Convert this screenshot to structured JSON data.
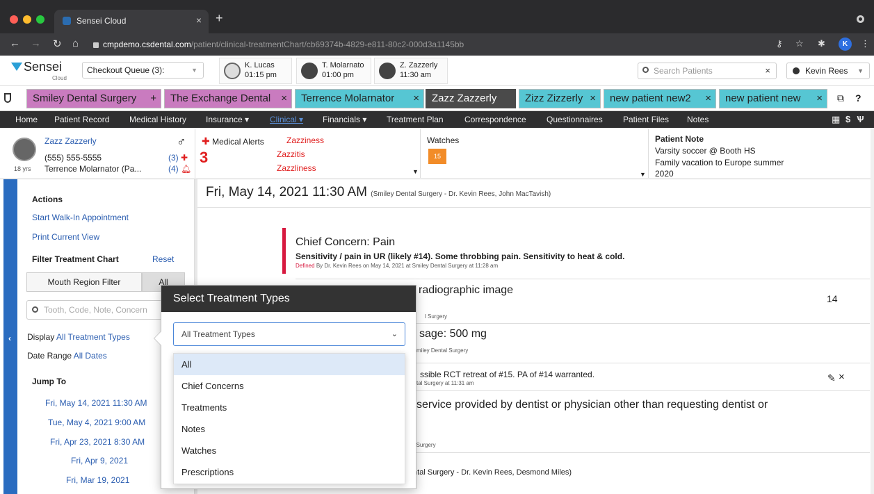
{
  "browser": {
    "tab_title": "Sensei Cloud",
    "url_host": "cmpdemo.csdental.com",
    "url_path": "/patient/clinical-treatmentChart/cb69374b-4829-e811-80c2-000d3a1145bb",
    "profile_initial": "K"
  },
  "app": {
    "logo_name": "Sensei",
    "logo_sub": "Cloud",
    "queue_label": "Checkout Queue (3):",
    "appointments": [
      {
        "name": "K. Lucas",
        "time": "01:15 pm"
      },
      {
        "name": "T. Molarnato",
        "time": "01:00 pm"
      },
      {
        "name": "Z. Zazzerly",
        "time": "11:30 am"
      }
    ],
    "search_placeholder": "Search Patients",
    "user_name": "Kevin Rees"
  },
  "patient_tabs": [
    {
      "label": "Smiley Dental Surgery",
      "color": "#c97bbf"
    },
    {
      "label": "The Exchange Dental",
      "color": "#c97bbf"
    },
    {
      "label": "Terrence Molarnator",
      "color": "#56c6d3"
    },
    {
      "label": "Zazz Zazzerly",
      "color": "#4a4a4a"
    },
    {
      "label": "Zizz Zizzerly",
      "color": "#56c6d3"
    },
    {
      "label": "new patient new2",
      "color": "#56c6d3"
    },
    {
      "label": "new patient new",
      "color": "#56c6d3"
    }
  ],
  "nav": {
    "items": [
      "Home",
      "Patient Record",
      "Medical History",
      "Insurance ▾",
      "Clinical ▾",
      "Financials ▾",
      "Treatment Plan",
      "Correspondence",
      "Questionnaires",
      "Patient Files",
      "Notes"
    ],
    "active": "Clinical ▾"
  },
  "patient": {
    "name": "Zazz Zazzerly",
    "phone": "(555) 555-5555",
    "provider": "Terrence Molarnator (Pa...",
    "age": "18 yrs",
    "gender_symbol": "♂",
    "count_a": "(3)",
    "count_b": "(4)",
    "medical_alerts_label": "Medical Alerts",
    "alert_count": "3",
    "alerts": [
      "Zazziness",
      "Zazzitis",
      "Zazzliness"
    ],
    "watches_label": "Watches",
    "watch_badge": "15",
    "note_title": "Patient Note",
    "note_lines": [
      "Varsity soccer @ Booth HS",
      "Family vacation to Europe summer",
      "2020"
    ]
  },
  "left_panel": {
    "actions_title": "Actions",
    "walk_in": "Start Walk-In Appointment",
    "print_view": "Print Current View",
    "filter_title": "Filter Treatment Chart",
    "reset": "Reset",
    "mouth_region": "Mouth Region Filter",
    "all": "All",
    "search_placeholder": "Tooth, Code, Note, Concern",
    "display_label": "Display",
    "display_value": "All Treatment Types",
    "date_label": "Date Range",
    "date_value": "All Dates",
    "jump_title": "Jump To",
    "jump_dates": [
      "Fri, May 14, 2021 11:30 AM",
      "Tue, May 4, 2021 9:00 AM",
      "Fri, Apr 23, 2021 8:30 AM",
      "Fri, Apr 9, 2021",
      "Fri, Mar 19, 2021"
    ]
  },
  "main": {
    "day_title": "Fri, May 14, 2021 11:30 AM",
    "day_sub": "(Smiley Dental Surgery - Dr. Kevin Rees, John MacTavish)",
    "cc_title": "Chief Concern: Pain",
    "cc_desc": "Sensitivity / pain in UR (likely #14). Some throbbing pain. Sensitivity to heat & cold.",
    "cc_meta_defined": "Defined",
    "cc_meta_rest": "By Dr. Kevin Rees on May 14, 2021 at Smiley Dental Surgery at 11:28 am",
    "e1_text": "radiographic image",
    "e1_sub": "l Surgery",
    "e1_tooth": "14",
    "e2_text": "sage: 500 mg",
    "e2_sub": "miley Dental Surgery",
    "e3_text": "ssible RCT retreat of #15. PA of #14 warranted.",
    "e3_sub": "tal Surgery at 11:31 am",
    "e4_text": "ic service provided by dentist or physician other than requesting dentist or",
    "e4_sub": "ental Surgery",
    "e5_text": "Dental Surgery - Dr. Kevin Rees, Desmond Miles)"
  },
  "popup": {
    "title": "Select Treatment Types",
    "selected": "All Treatment Types",
    "options": [
      "All",
      "Chief Concerns",
      "Treatments",
      "Notes",
      "Watches",
      "Prescriptions"
    ]
  }
}
